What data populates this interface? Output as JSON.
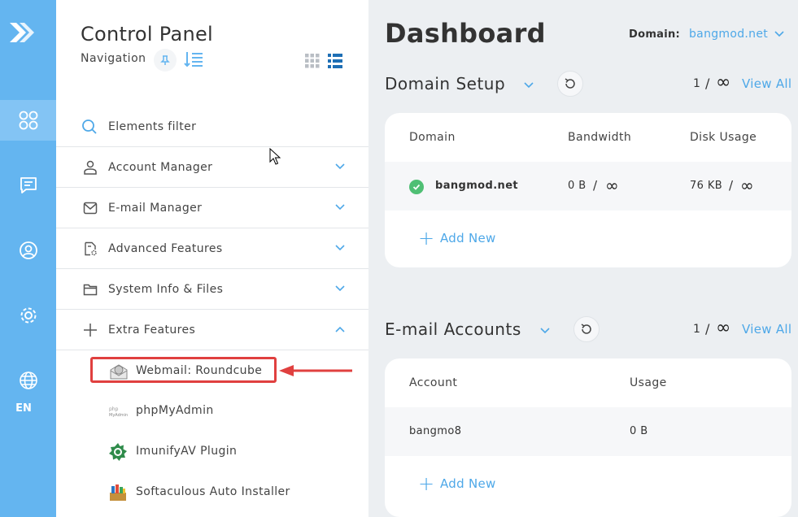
{
  "rail": {
    "lang": "EN"
  },
  "nav": {
    "title": "Control Panel",
    "subtitle": "Navigation",
    "filter_label": "Elements filter",
    "menu": [
      {
        "label": "Account Manager",
        "icon": "user-icon",
        "expanded": false
      },
      {
        "label": "E-mail Manager",
        "icon": "envelope-icon",
        "expanded": false
      },
      {
        "label": "Advanced Features",
        "icon": "document-gear-icon",
        "expanded": false
      },
      {
        "label": "System Info & Files",
        "icon": "folder-icon",
        "expanded": false
      },
      {
        "label": "Extra Features",
        "icon": "plus-icon",
        "expanded": true
      }
    ],
    "extra": [
      {
        "label": "Webmail: Roundcube",
        "icon": "roundcube-icon"
      },
      {
        "label": "phpMyAdmin",
        "icon": "phpmyadmin-icon"
      },
      {
        "label": "ImunifyAV Plugin",
        "icon": "imunify-icon"
      },
      {
        "label": "Softaculous Auto Installer",
        "icon": "softaculous-icon"
      }
    ]
  },
  "main": {
    "title": "Dashboard",
    "domain_label": "Domain:",
    "domain_value": "bangmod.net",
    "domain_setup": {
      "title": "Domain Setup",
      "count": "1",
      "slash": "/",
      "infinity": "∞",
      "view_all": "View All",
      "headers": [
        "Domain",
        "Bandwidth",
        "Disk Usage"
      ],
      "rows": [
        {
          "domain": "bangmod.net",
          "bandwidth": "0 B",
          "disk": "76 KB",
          "slash": "/",
          "infinity": "∞"
        }
      ],
      "add_new": "Add New"
    },
    "email_accounts": {
      "title": "E-mail Accounts",
      "count": "1",
      "slash": "/",
      "infinity": "∞",
      "view_all": "View All",
      "headers": [
        "Account",
        "Usage"
      ],
      "rows": [
        {
          "account": "bangmo8",
          "usage": "0 B"
        }
      ],
      "add_new": "Add New"
    }
  },
  "colors": {
    "rail": "#64b5f0",
    "accent": "#4ea8e8",
    "highlight_border": "#e0403f",
    "success": "#4fbf74"
  }
}
